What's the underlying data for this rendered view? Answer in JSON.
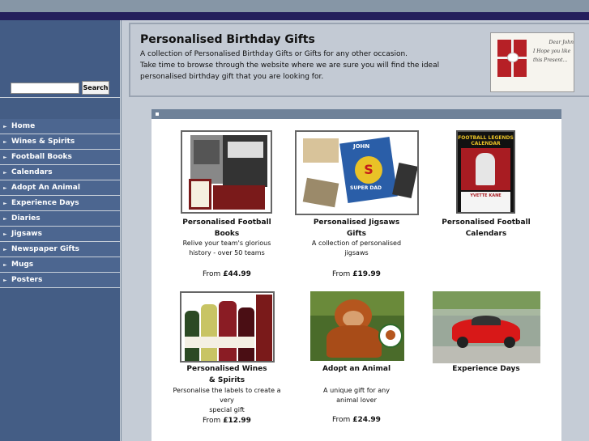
{
  "search": {
    "placeholder": "",
    "button_label": "Search"
  },
  "nav": [
    {
      "label": "Home"
    },
    {
      "label": "Wines & Spirits"
    },
    {
      "label": "Football Books"
    },
    {
      "label": "Calendars"
    },
    {
      "label": "Adopt An Animal"
    },
    {
      "label": "Experience Days"
    },
    {
      "label": "Diaries"
    },
    {
      "label": "Jigsaws"
    },
    {
      "label": "Newspaper Gifts"
    },
    {
      "label": "Mugs"
    },
    {
      "label": "Posters"
    }
  ],
  "header": {
    "title": "Personalised Birthday Gifts",
    "desc_line1": "A collection of Personalised Birthday Gifts or Gifts for any other occasion.",
    "desc_line2": "Take time to browse through the website where we are sure you will find the ideal",
    "desc_line3": "personalised birthday gift that you are looking for.",
    "card_text1": "Dear John",
    "card_text2": "I Hope you like this Present..."
  },
  "products": [
    {
      "title1": "Personalised Football",
      "title2": "Books",
      "desc1": "Relive your team's glorious",
      "desc2": "history - over 50 teams",
      "price_prefix": "From",
      "price": "£44.99"
    },
    {
      "title1": "Personalised Jigsaws",
      "title2": "Gifts",
      "desc1": "A collection of personalised",
      "desc2": "jigsaws",
      "price_prefix": "From",
      "price": "£19.99"
    },
    {
      "title1": "Personalised Football",
      "title2": "Calendars",
      "desc1": "",
      "desc2": "",
      "price_prefix": "",
      "price": ""
    },
    {
      "title1": "Personalised Wines",
      "title2": "& Spirits",
      "desc1": "Personalise the labels to create a very",
      "desc2": "special gift",
      "price_prefix": "From",
      "price": "£12.99"
    },
    {
      "title1": "Adopt an Animal",
      "title2": "",
      "desc1": "A unique gift for any",
      "desc2": "animal lover",
      "price_prefix": "From",
      "price": "£24.99"
    },
    {
      "title1": "Experience Days",
      "title2": "",
      "desc1": "",
      "desc2": "",
      "price_prefix": "",
      "price": ""
    }
  ],
  "calendar_img": {
    "heading1": "FOOTBALL LEGENDS",
    "heading2": "CALENDAR",
    "name": "YVETTE KANE"
  },
  "jigsaw_img": {
    "name": "JOHN",
    "text": "SUPER DAD"
  },
  "colors": {
    "sidebar": "#445d85",
    "topbar": "#241f5c",
    "panel_head": "#6f8299",
    "background": "#c5ccd6"
  }
}
